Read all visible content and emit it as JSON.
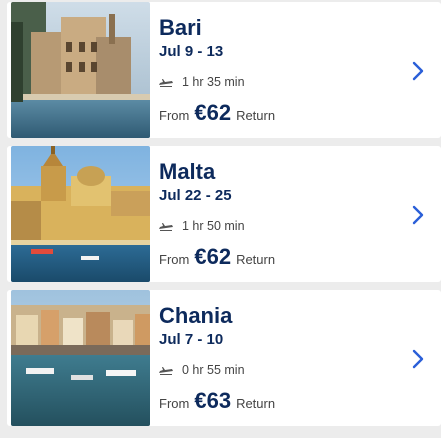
{
  "destinations": [
    {
      "city": "Bari",
      "dates": "Jul 9 - 13",
      "duration": "1 hr 35 min",
      "from_label": "From",
      "price": "€62",
      "trip_type": "Return"
    },
    {
      "city": "Malta",
      "dates": "Jul 22 - 25",
      "duration": "1 hr 50 min",
      "from_label": "From",
      "price": "€62",
      "trip_type": "Return"
    },
    {
      "city": "Chania",
      "dates": "Jul 7 - 10",
      "duration": "0 hr 55 min",
      "from_label": "From",
      "price": "€63",
      "trip_type": "Return"
    }
  ],
  "icons": {
    "flight": "plane-icon",
    "chevron": "chevron-right-icon"
  },
  "colors": {
    "title": "#0d2a5c",
    "chevron": "#2a5fd8",
    "background": "#ececec"
  }
}
